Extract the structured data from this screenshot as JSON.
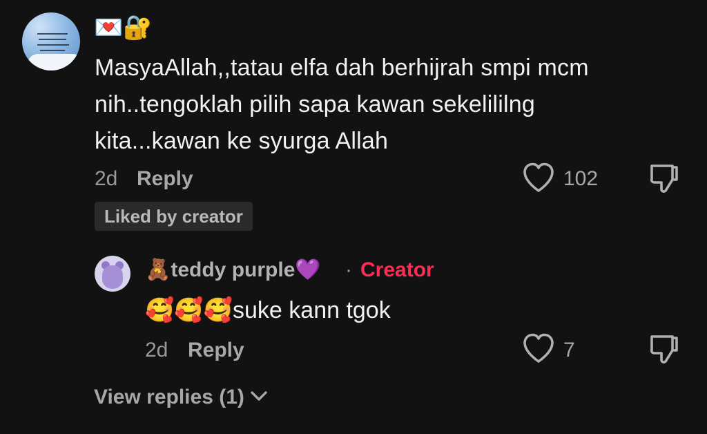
{
  "main_comment": {
    "badges": "💌🔐",
    "text": "MasyaAllah,,tatau elfa dah berhijrah smpi mcm nih..tengoklah pilih sapa kawan sekelililng kita...kawan ke syurga Allah",
    "time": "2d",
    "reply_label": "Reply",
    "like_count": "102",
    "liked_by_creator": "Liked by creator"
  },
  "reply_comment": {
    "author_emoji": "🧸",
    "author_name": "teddy purple",
    "author_emoji_after": "💜",
    "separator": "·",
    "creator_label": "Creator",
    "text_emojis": "🥰🥰🥰",
    "text": "suke kann tgok",
    "time": "2d",
    "reply_label": "Reply",
    "like_count": "7"
  },
  "view_replies_label": "View replies (1)",
  "colors": {
    "background": "#121212",
    "creator_accent": "#fe2c55",
    "muted_text": "#a8a8a8"
  },
  "icons": [
    "heart-outline-icon",
    "dislike-icon",
    "chevron-down-icon"
  ]
}
